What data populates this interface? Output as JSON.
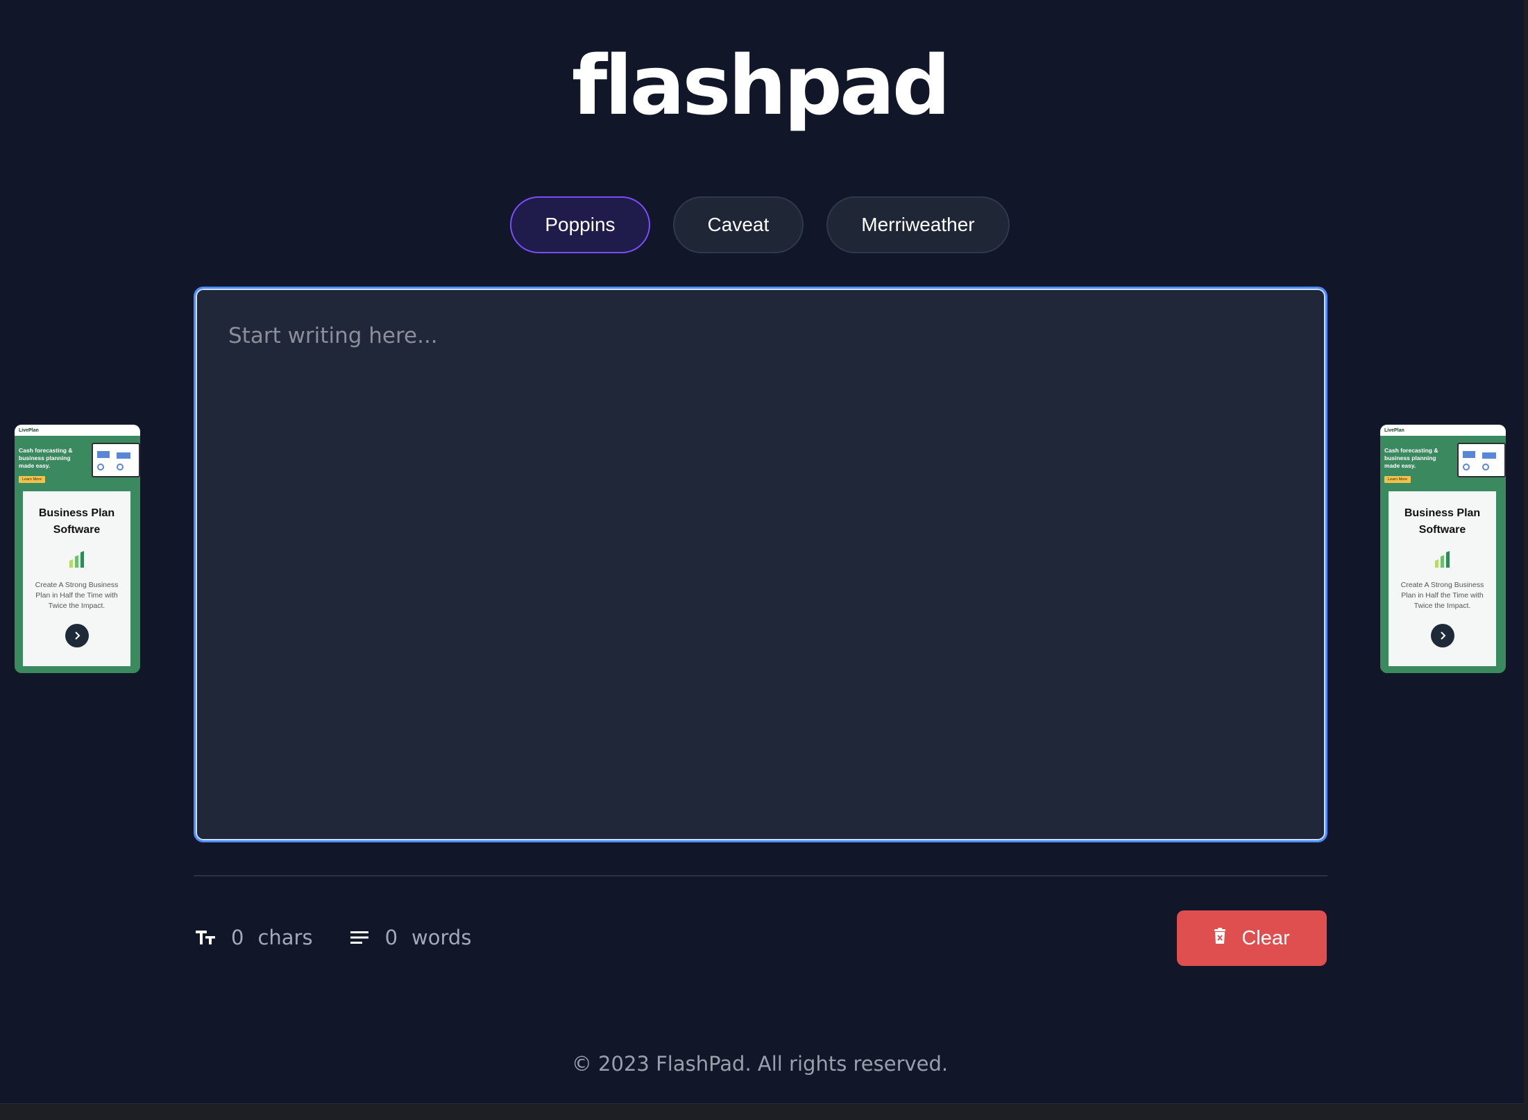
{
  "header": {
    "brand": "flashpad"
  },
  "fonts": {
    "tabs": [
      {
        "label": "Poppins",
        "active": true
      },
      {
        "label": "Caveat",
        "active": false
      },
      {
        "label": "Merriweather",
        "active": false
      }
    ]
  },
  "editor": {
    "placeholder": "Start writing here...",
    "value": ""
  },
  "stats": {
    "chars_count": "0",
    "chars_label": "chars",
    "words_count": "0",
    "words_label": "words",
    "chars_icon": "text-size-icon",
    "words_icon": "lines-icon"
  },
  "actions": {
    "clear_label": "Clear",
    "clear_icon": "trash-icon"
  },
  "footer": {
    "copyright": "© 2023 FlashPad. All rights reserved."
  },
  "ads": {
    "logo": "LivePlan",
    "tagline": "Cash forecasting & business planning made easy.",
    "learn_more": "Learn More",
    "title": "Business Plan Software",
    "description": "Create A Strong Business Plan in Half the Time with Twice the Impact.",
    "arrow_icon": "chevron-right-icon"
  },
  "colors": {
    "background": "#111629",
    "accent": "#7c4dff",
    "editor_border": "#4c8dff",
    "clear_button": "#df4f4f",
    "ad_green": "#3b8a5f"
  }
}
